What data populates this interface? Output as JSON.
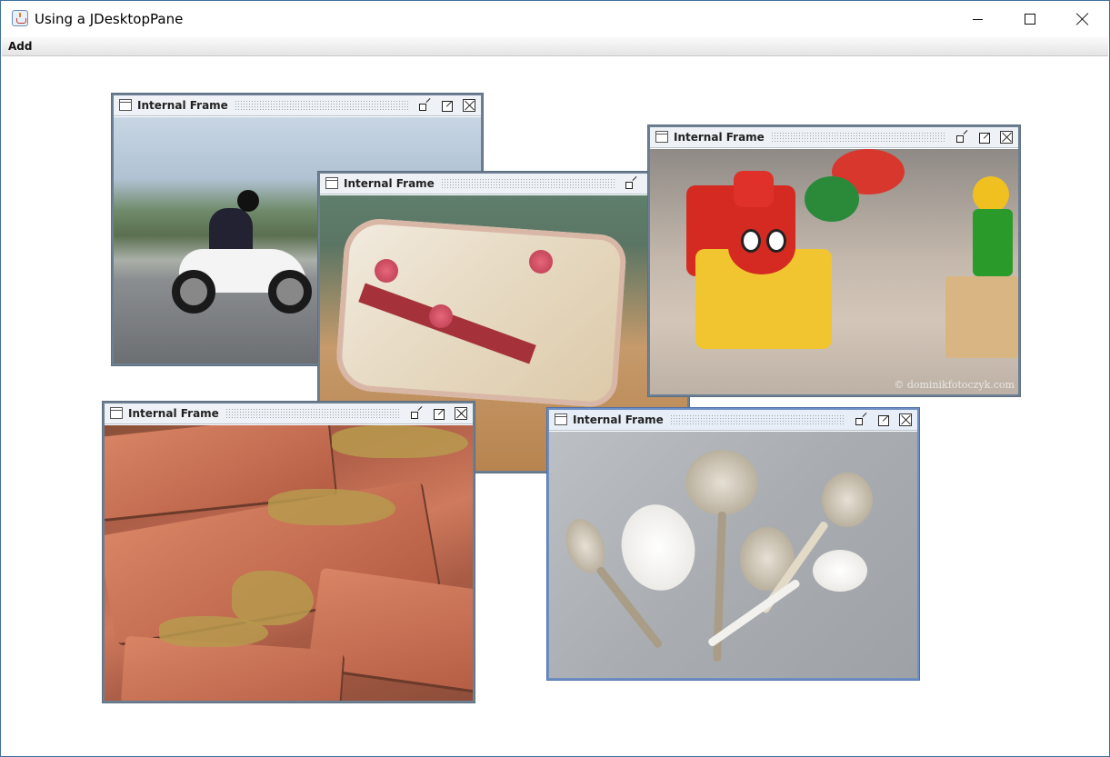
{
  "window": {
    "title": "Using a JDesktopPane",
    "controls": {
      "minimize": "minimize",
      "maximize": "maximize",
      "close": "close"
    }
  },
  "menubar": {
    "items": [
      {
        "label": "Add"
      }
    ]
  },
  "internal_frames": [
    {
      "title": "Internal Frame",
      "image": "motorcycle"
    },
    {
      "title": "Internal Frame",
      "image": "fabric-seed-book"
    },
    {
      "title": "Internal Frame",
      "image": "toy-train"
    },
    {
      "title": "Internal Frame",
      "image": "bricks"
    },
    {
      "title": "Internal Frame",
      "image": "spoons"
    }
  ],
  "photo_watermark": "© dominikfotoczyk.com",
  "colors": {
    "frame_border": "#6d7f93",
    "active_frame_border": "#6d8fc4",
    "desktop_background": "#ffffff"
  }
}
